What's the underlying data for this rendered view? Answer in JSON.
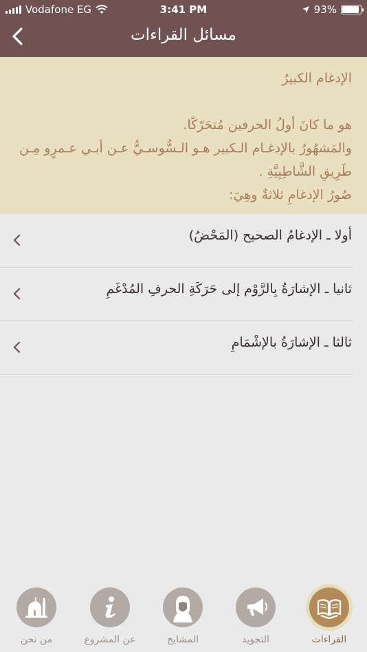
{
  "status": {
    "carrier": "Vodafone EG",
    "time": "3:41 PM",
    "battery": "93%"
  },
  "header": {
    "title": "مسائل القراءات"
  },
  "intro": {
    "heading": "الإدغام الكبيرُ",
    "lines": [
      "هو ما كانَ أولُ الحرفين مُتحَرّكًا.",
      "والمَشهُورُ بالإدغـام الـكبير هـو الـسُّوسـيُّ عـن أبـي عـمرٍو مِـن",
      "طَرِيقِ الشَّاطِبِيَّةِ .",
      "صُورُ الإدغامِ ثلاثةٌ وهِيَ:"
    ]
  },
  "items": [
    {
      "label": "أولا ـ الإدغامُ الصحيح (المَحْضُ)"
    },
    {
      "label": "ثانيا ـ الإشارَةُ بِالرَّوْم إلى حَرَكَةِ الحرفِ المُدْغَمِ"
    },
    {
      "label": "ثالثا ـ الإشارَةُ بالإشْمَامِ"
    }
  ],
  "tabs": [
    {
      "label": "القراءات",
      "icon": "quran-book-icon",
      "active": true
    },
    {
      "label": "التجويد",
      "icon": "megaphone-icon",
      "active": false
    },
    {
      "label": "المشايخ",
      "icon": "sheikh-portrait-icon",
      "active": false
    },
    {
      "label": "عن المشروع",
      "icon": "info-icon",
      "active": false
    },
    {
      "label": "من نحن",
      "icon": "mosque-icon",
      "active": false
    }
  ],
  "colors": {
    "header": "#705252",
    "intro_bg": "#e9e0bf",
    "intro_text": "#a87c5e",
    "active_tab": "#b38b58"
  }
}
